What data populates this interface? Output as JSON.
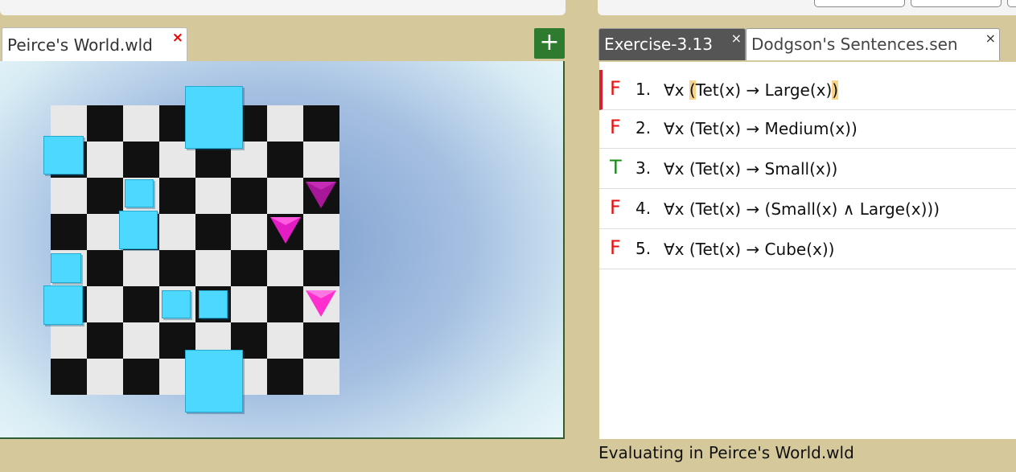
{
  "world_tab": {
    "label": "Peirce's World.wld",
    "close": "×"
  },
  "add_button": {
    "label": "+"
  },
  "sentence_tabs": [
    {
      "label": "Exercise-3.13",
      "close": "×"
    },
    {
      "label": "Dodgson's Sentences.sen",
      "close": "×"
    }
  ],
  "sentences": [
    {
      "truth": "F",
      "number": "1.",
      "formula_pre": "∀x ",
      "paren_open": "(",
      "formula_mid": "Tet(x) → Large(x)",
      "paren_close": ")",
      "selected": true
    },
    {
      "truth": "F",
      "number": "2.",
      "formula": "∀x (Tet(x) → Medium(x))"
    },
    {
      "truth": "T",
      "number": "3.",
      "formula": "∀x (Tet(x) → Small(x))"
    },
    {
      "truth": "F",
      "number": "4.",
      "formula": "∀x (Tet(x) → (Small(x) ∧ Large(x)))"
    },
    {
      "truth": "F",
      "number": "5.",
      "formula": "∀x (Tet(x) → Cube(x))"
    }
  ],
  "status": "Evaluating in Peirce's World.wld",
  "colors": {
    "true": "#1a8a1a",
    "false": "#e81010",
    "cube": "#4dd8ff",
    "tet": "#ff2ecf",
    "add_button": "#2e7a2e"
  }
}
